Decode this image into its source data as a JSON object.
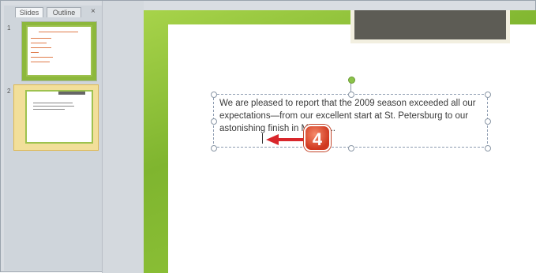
{
  "pane": {
    "tabs": [
      "Slides",
      "Outline"
    ],
    "close": "×",
    "thumbnails": [
      {
        "number": "1"
      },
      {
        "number": "2"
      }
    ]
  },
  "slide": {
    "body_text": "We are pleased to report that the 2009 season exceeded all our expectations—from our excellent start at St. Petersburg to our astonishing finish in Miami ..."
  },
  "annotation": {
    "step": "4"
  },
  "colors": {
    "accent_green": "#8db83c",
    "arrow_red": "#d8262b"
  }
}
